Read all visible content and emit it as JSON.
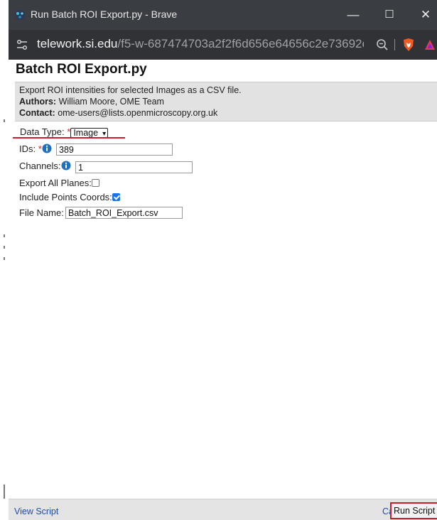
{
  "window": {
    "title": "Run Batch ROI Export.py - Brave",
    "minimize_glyph": "—",
    "maximize_glyph": "☐",
    "close_glyph": "✕"
  },
  "address": {
    "host": "telework.si.edu",
    "path": "/f5-w-687474703a2f2f6d656e64656c2e73692e6..."
  },
  "page": {
    "title": "Batch ROI Export.py",
    "description": "Export ROI intensities for selected Images as a CSV file.",
    "authors_label": "Authors:",
    "authors_value": "William Moore, OME Team",
    "contact_label": "Contact:",
    "contact_value": "ome-users@lists.openmicroscopy.org.uk"
  },
  "form": {
    "data_type_label": "Data Type:",
    "required_mark": "*",
    "data_type_value": "Image",
    "ids_label": "IDs:",
    "ids_value": "389",
    "channels_label": "Channels:",
    "channels_value": "1",
    "export_all_planes_label": "Export All Planes:",
    "export_all_planes_checked": false,
    "include_points_label": "Include Points Coords:",
    "include_points_checked": true,
    "file_name_label": "File Name:",
    "file_name_value": "Batch_ROI_Export.csv"
  },
  "footer": {
    "view_script": "View Script",
    "cancel": "Cancel",
    "run_script": "Run Script"
  },
  "colors": {
    "titlebar_bg": "#3a3d41",
    "addressbar_bg": "#303236",
    "highlight_red": "#c8202b",
    "link_blue": "#1a4db3",
    "checkbox_blue": "#1a73e8"
  }
}
